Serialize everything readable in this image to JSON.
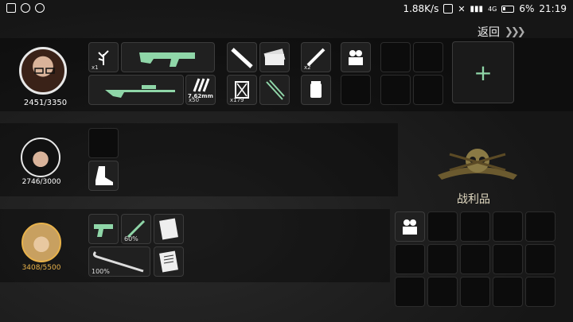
{
  "status_bar": {
    "speed": "1.88K/s",
    "battery": "6%",
    "time": "21:19",
    "network": "4G"
  },
  "back": {
    "label": "返回"
  },
  "characters": [
    {
      "hp": "2451/3350",
      "hp_color": "#ffffff"
    },
    {
      "hp": "2746/3000",
      "hp_color": "#ffffff"
    },
    {
      "hp": "3408/5500",
      "hp_color": "#e8b24a"
    }
  ],
  "items": {
    "herb_count": "x1",
    "ammo_label": "7.62mm",
    "ammo_count": "x50",
    "syringe_count": "x2",
    "fuel_count": "x179",
    "knife_durability": "60%",
    "crowbar_durability": "100%"
  },
  "loot": {
    "title": "战利品"
  },
  "colors": {
    "accent": "#8fd6a8",
    "gold": "#e8b24a"
  }
}
